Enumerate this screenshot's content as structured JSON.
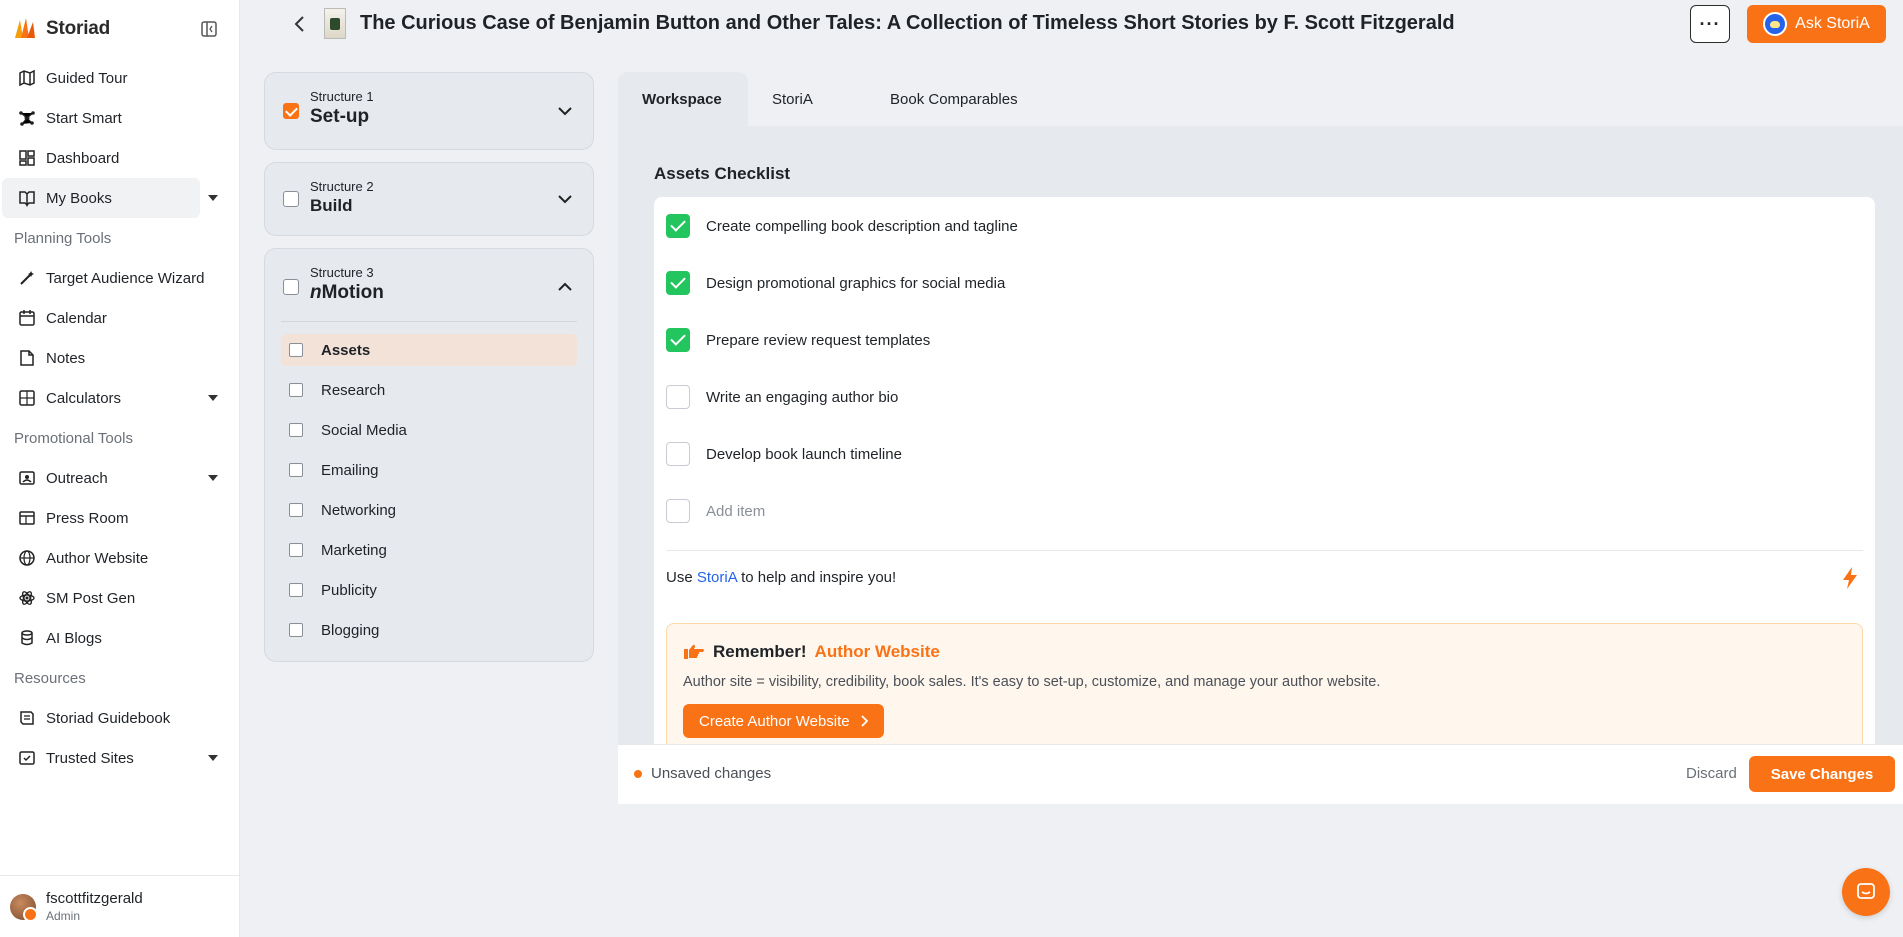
{
  "app": {
    "name": "Storiad"
  },
  "sidebar": {
    "items": [
      {
        "label": "Guided Tour",
        "icon": "map-icon"
      },
      {
        "label": "Start Smart",
        "icon": "sparkle-network-icon"
      },
      {
        "label": "Dashboard",
        "icon": "dashboard-icon"
      },
      {
        "label": "My Books",
        "icon": "book-open-icon",
        "active": true,
        "expandable": true
      },
      {
        "section": "Planning Tools"
      },
      {
        "label": "Target Audience Wizard",
        "icon": "magic-wand-icon"
      },
      {
        "label": "Calendar",
        "icon": "calendar-icon"
      },
      {
        "label": "Notes",
        "icon": "note-icon"
      },
      {
        "label": "Calculators",
        "icon": "calculator-icon",
        "expandable": true
      },
      {
        "section": "Promotional Tools"
      },
      {
        "label": "Outreach",
        "icon": "contact-card-icon",
        "expandable": true
      },
      {
        "label": "Press Room",
        "icon": "newspaper-icon"
      },
      {
        "label": "Author Website",
        "icon": "globe-icon"
      },
      {
        "label": "SM Post Gen",
        "icon": "atom-icon"
      },
      {
        "label": "AI Blogs",
        "icon": "stack-icon"
      },
      {
        "section": "Resources"
      },
      {
        "label": "Storiad Guidebook",
        "icon": "guidebook-icon"
      },
      {
        "label": "Trusted Sites",
        "icon": "checked-window-icon",
        "expandable": true
      }
    ],
    "user": {
      "name": "fscottfitzgerald",
      "role": "Admin"
    }
  },
  "header": {
    "title": "The Curious Case of Benjamin Button and Other Tales: A Collection of Timeless Short Stories by F. Scott Fitzgerald",
    "more_label": "···",
    "ask_label": "Ask StoriA"
  },
  "structures": [
    {
      "label": "Structure 1",
      "name": "Set-up",
      "checked": true,
      "expanded": false
    },
    {
      "label": "Structure 2",
      "name": "Build",
      "checked": false,
      "expanded": false
    },
    {
      "label": "Structure 3",
      "name_prefix": "n",
      "name": "Motion",
      "checked": false,
      "expanded": true,
      "items": [
        "Assets",
        "Research",
        "Social Media",
        "Emailing",
        "Networking",
        "Marketing",
        "Publicity",
        "Blogging"
      ],
      "active_item": "Assets"
    }
  ],
  "tabs": [
    {
      "label": "Workspace",
      "active": true
    },
    {
      "label": "StoriA",
      "active": false
    },
    {
      "label": "Book Comparables",
      "active": false
    }
  ],
  "checklist": {
    "title": "Assets Checklist",
    "items": [
      {
        "text": "Create compelling book description and tagline",
        "checked": true
      },
      {
        "text": "Design promotional graphics for social media",
        "checked": true
      },
      {
        "text": "Prepare review request templates",
        "checked": true
      },
      {
        "text": "Write an engaging author bio",
        "checked": false
      },
      {
        "text": "Develop book launch timeline",
        "checked": false
      }
    ],
    "add_placeholder": "Add item",
    "hint_prefix": "Use",
    "hint_link": "StoriA",
    "hint_suffix": "to help and inspire you!"
  },
  "remember": {
    "label": "Remember!",
    "topic": "Author Website",
    "body": "Author site = visibility, credibility, book sales. It's easy to set-up, customize, and manage your author website.",
    "button": "Create Author Website"
  },
  "footer": {
    "status": "Unsaved changes",
    "discard": "Discard",
    "save": "Save Changes"
  },
  "colors": {
    "accent": "#f97316",
    "success": "#22c55e",
    "link": "#2563eb"
  }
}
